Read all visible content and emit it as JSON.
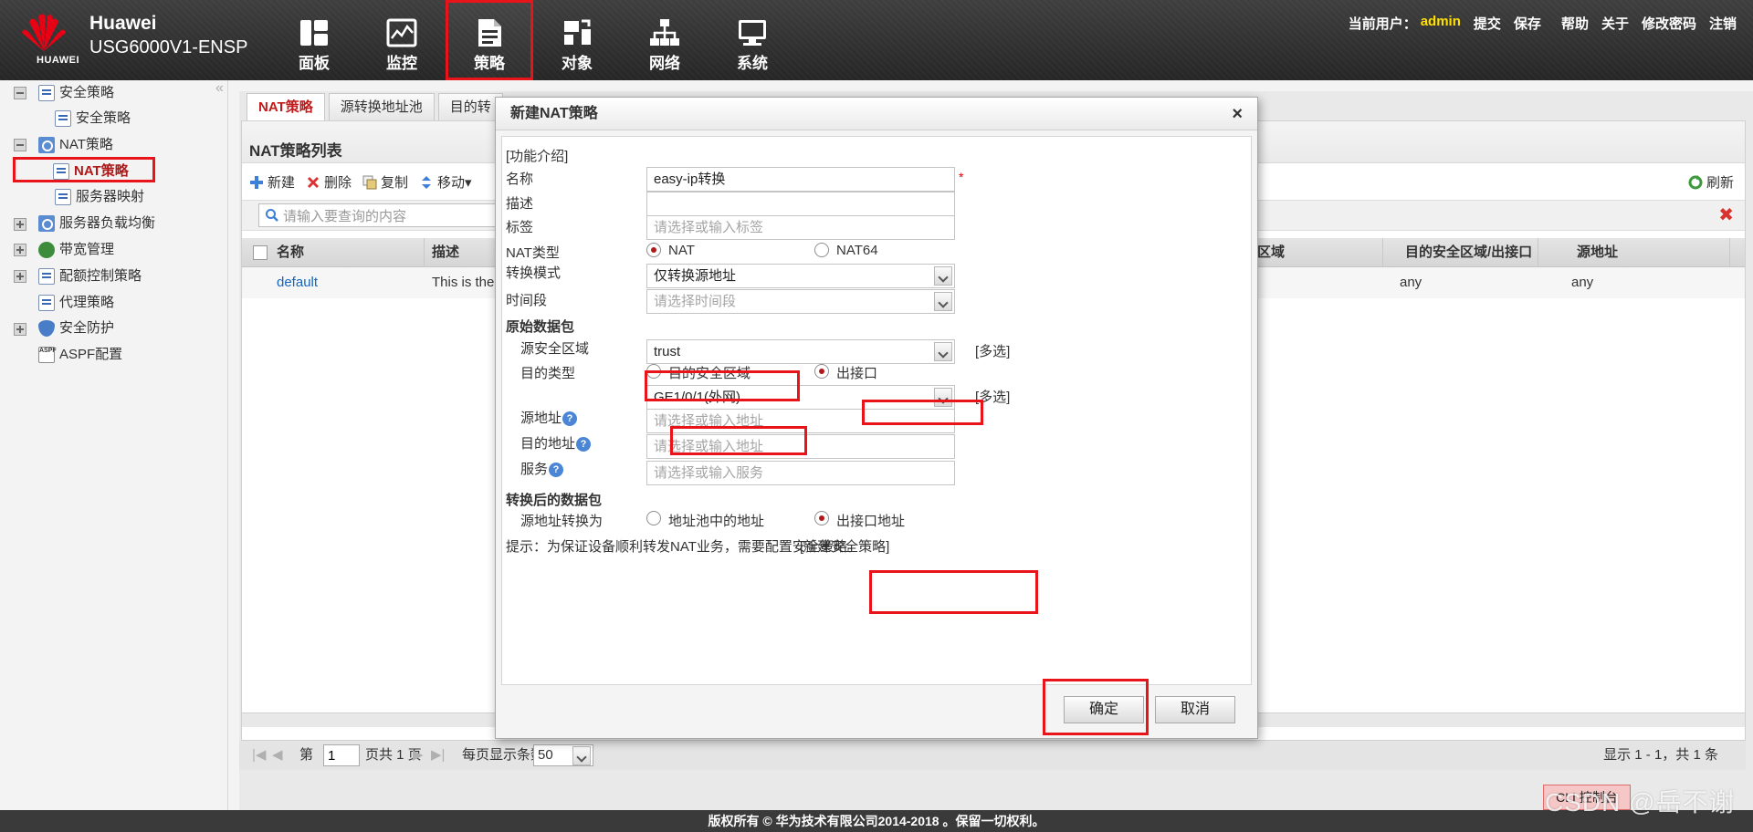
{
  "header": {
    "brand_small": "HUAWEI",
    "brand": "Huawei",
    "model": "USG6000V1-ENSP",
    "nav": [
      {
        "label": "面板",
        "icon": "dashboard-icon"
      },
      {
        "label": "监控",
        "icon": "monitor-icon"
      },
      {
        "label": "策略",
        "icon": "policy-icon"
      },
      {
        "label": "对象",
        "icon": "object-icon"
      },
      {
        "label": "网络",
        "icon": "network-icon"
      },
      {
        "label": "系统",
        "icon": "system-icon"
      }
    ],
    "current_user_label": "当前用户：",
    "current_user": "admin",
    "actions": {
      "submit": "提交",
      "save": "保存",
      "help": "帮助",
      "about": "关于",
      "change_password": "修改密码",
      "logout": "注销"
    }
  },
  "sidebar": {
    "items": [
      {
        "label": "安全策略"
      },
      {
        "label": "安全策略"
      },
      {
        "label": "NAT策略"
      },
      {
        "label": "NAT策略"
      },
      {
        "label": "服务器映射"
      },
      {
        "label": "服务器负载均衡"
      },
      {
        "label": "带宽管理"
      },
      {
        "label": "配额控制策略"
      },
      {
        "label": "代理策略"
      },
      {
        "label": "安全防护"
      },
      {
        "label": "ASPF配置"
      }
    ]
  },
  "main": {
    "tabs": [
      {
        "label": "NAT策略"
      },
      {
        "label": "源转换地址池"
      },
      {
        "label": "目的转"
      }
    ],
    "panel_title": "NAT策略列表",
    "toolbar": {
      "add": "新建",
      "delete": "删除",
      "copy": "复制",
      "move": "移动▾",
      "refresh": "刷新"
    },
    "search_placeholder": "请输入要查询的内容",
    "columns": [
      "名称",
      "描述",
      "全区域",
      "目的安全区域/出接口",
      "源地址"
    ],
    "rows": [
      {
        "name": "default",
        "desc": "This is the d",
        "dst_zone": "any",
        "src_addr": "any"
      }
    ],
    "pager": {
      "page_prefix": "第",
      "page": "1",
      "page_suffix": "页共 1 页",
      "per_page_label": "每页显示条数",
      "per_page": "50",
      "summary": "显示 1 - 1，共 1 条"
    }
  },
  "dialog": {
    "title": "新建NAT策略",
    "intro_link": "[功能介绍]",
    "labels": {
      "name": "名称",
      "desc": "描述",
      "tag": "标签",
      "nat_type": "NAT类型",
      "mode": "转换模式",
      "time": "时间段",
      "orig_section": "原始数据包",
      "src_zone": "源安全区域",
      "dst_type": "目的类型",
      "src_addr": "源地址",
      "dst_addr": "目的地址",
      "service": "服务",
      "post_section": "转换后的数据包",
      "src_translate": "源地址转换为"
    },
    "values": {
      "name": "easy-ip转换",
      "required_mark": "*",
      "nat_type_nat": "NAT",
      "nat_type_nat64": "NAT64",
      "mode": "仅转换源地址",
      "src_zone": "trust",
      "dst_type_zone": "目的安全区域",
      "dst_type_iface": "出接口",
      "iface": "GE1/0/1(外网)",
      "pool_addr": "地址池中的地址",
      "iface_addr": "出接口地址",
      "multi": "[多选]"
    },
    "placeholders": {
      "tag": "请选择或输入标签",
      "time": "请选择时间段",
      "src_addr": "请选择或输入地址",
      "dst_addr": "请选择或输入地址",
      "service": "请选择或输入服务"
    },
    "hint": "提示：为保证设备顺利转发NAT业务，需要配置安全策略。",
    "hint_link": "[新建安全策略]",
    "ok": "确定",
    "cancel": "取消"
  },
  "footer": {
    "copyright": "版权所有 © 华为技术有限公司2014-2018 。保留一切权利。",
    "cli": "CLI 控制台",
    "watermark": "CSDN @岳不谢"
  },
  "colors": {
    "accent_red": "#e8141a",
    "link_blue": "#1565c0",
    "user_yellow": "#ffe000"
  }
}
